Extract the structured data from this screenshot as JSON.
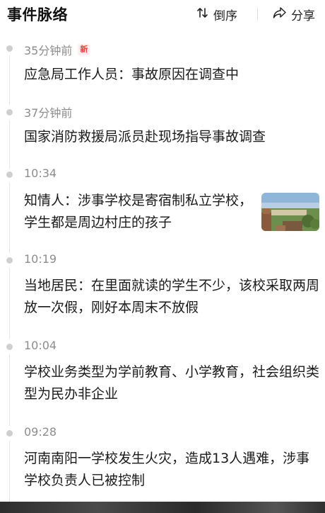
{
  "header": {
    "title": "事件脉络",
    "sort_label": "倒序",
    "share_label": "分享",
    "sort_icon": "sort-arrows-icon",
    "share_icon": "share-arrow-icon"
  },
  "timeline": {
    "items": [
      {
        "time": "35分钟前",
        "badge": "新",
        "text": "应急局工作人员：事故原因在调查中"
      },
      {
        "time": "37分钟前",
        "text": "国家消防救援局派员赴现场指导事故调查"
      },
      {
        "time": "10:34",
        "text": "知情人：涉事学校是寄宿制私立学校，学生都是周边村庄的孩子",
        "has_image": true
      },
      {
        "time": "10:19",
        "text": "当地居民：在里面就读的学生不少，该校采取两周放一次假，刚好本周末不放假"
      },
      {
        "time": "10:04",
        "text": "学校业务类型为学前教育、小学教育，社会组织类型为民办非企业"
      },
      {
        "time": "09:28",
        "text": "河南南阳一学校发生火灾，造成13人遇难，涉事学校负责人已被控制"
      }
    ]
  },
  "colors": {
    "badge": "#ff3b30",
    "time_text": "#8c8c8c",
    "dot": "#cfcfcf"
  }
}
